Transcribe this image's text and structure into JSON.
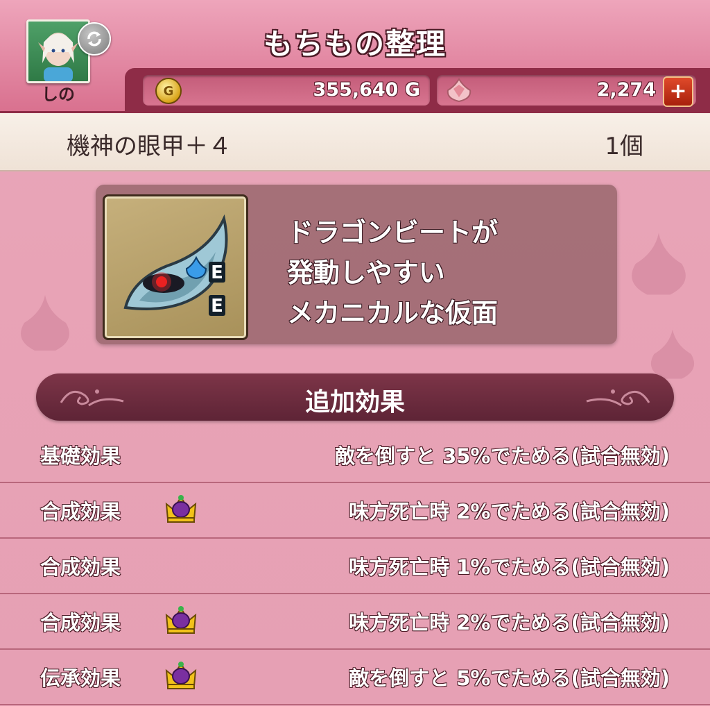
{
  "header": {
    "title": "もちもの整理",
    "player_name": "しの",
    "money": {
      "coin_symbol": "G",
      "value": "355,640 G"
    },
    "gems": {
      "value": "2,274",
      "add_symbol": "+"
    }
  },
  "item": {
    "name": "機神の眼甲＋４",
    "count": "1個",
    "icon": "mechanical-mask-icon",
    "badges": [
      "E",
      "E"
    ],
    "description": [
      "ドラゴンビートが",
      "発動しやすい",
      "メカニカルな仮面"
    ]
  },
  "effects_section": {
    "title": "追加効果",
    "rows": [
      {
        "label": "基礎効果",
        "crown": false,
        "value": "敵を倒すと 35%でためる(試合無効)"
      },
      {
        "label": "合成効果",
        "crown": true,
        "value": "味方死亡時 2%でためる(試合無効)"
      },
      {
        "label": "合成効果",
        "crown": false,
        "value": "味方死亡時 1%でためる(試合無効)"
      },
      {
        "label": "合成効果",
        "crown": true,
        "value": "味方死亡時 2%でためる(試合無効)"
      },
      {
        "label": "伝承効果",
        "crown": true,
        "value": "敵を倒すと 5%でためる(試合無効)"
      }
    ]
  },
  "colors": {
    "background": "#e8a3b6",
    "header_dark": "#8e2c47",
    "section_header": "#6b2a3d",
    "item_bar": "#f3e8de"
  }
}
